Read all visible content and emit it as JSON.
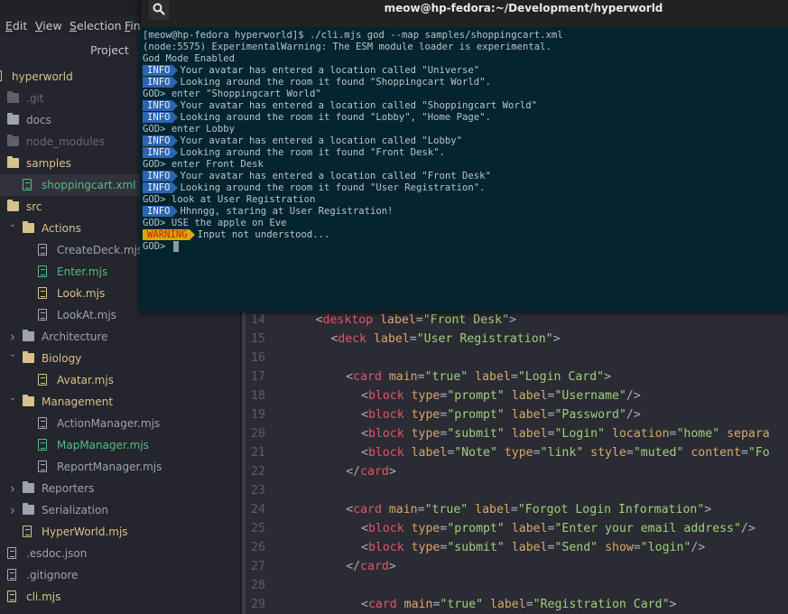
{
  "menubar": {
    "items": [
      {
        "label": "Edit",
        "mnemonic": "E",
        "rest": "dit"
      },
      {
        "label": "View",
        "mnemonic": "V",
        "rest": "iew"
      },
      {
        "label": "Selection",
        "mnemonic": "S",
        "rest": "election"
      },
      {
        "label": "Find",
        "mnemonic": "F",
        "rest": "in"
      }
    ]
  },
  "sidebar": {
    "title": "Project",
    "items": [
      {
        "label": "hyperworld",
        "kind": "root",
        "color": "yellow"
      },
      {
        "label": ".git",
        "kind": "folder",
        "color": "dim"
      },
      {
        "label": "docs",
        "kind": "folder",
        "color": "grey"
      },
      {
        "label": "node_modules",
        "kind": "folder",
        "color": "dim"
      },
      {
        "label": "samples",
        "kind": "folder",
        "color": "yellow"
      },
      {
        "label": "shoppingcart.xml",
        "kind": "file",
        "color": "green",
        "selected": true
      },
      {
        "label": "src",
        "kind": "folder",
        "color": "yellow"
      },
      {
        "label": "Actions",
        "kind": "folder",
        "color": "yellow",
        "expanded": true
      },
      {
        "label": "CreateDeck.mjs",
        "kind": "file",
        "color": "grey"
      },
      {
        "label": "Enter.mjs",
        "kind": "file",
        "color": "green"
      },
      {
        "label": "Look.mjs",
        "kind": "file",
        "color": "yellow"
      },
      {
        "label": "LookAt.mjs",
        "kind": "file",
        "color": "grey"
      },
      {
        "label": "Architecture",
        "kind": "folder",
        "color": "grey",
        "expanded": false
      },
      {
        "label": "Biology",
        "kind": "folder",
        "color": "yellow",
        "expanded": true
      },
      {
        "label": "Avatar.mjs",
        "kind": "file",
        "color": "yellow"
      },
      {
        "label": "Management",
        "kind": "folder",
        "color": "yellow",
        "expanded": true
      },
      {
        "label": "ActionManager.mjs",
        "kind": "file",
        "color": "grey"
      },
      {
        "label": "MapManager.mjs",
        "kind": "file",
        "color": "green"
      },
      {
        "label": "ReportManager.mjs",
        "kind": "file",
        "color": "grey"
      },
      {
        "label": "Reporters",
        "kind": "folder",
        "color": "grey",
        "expanded": false
      },
      {
        "label": "Serialization",
        "kind": "folder",
        "color": "grey",
        "expanded": false
      },
      {
        "label": "HyperWorld.mjs",
        "kind": "file",
        "color": "yellow"
      },
      {
        "label": ".esdoc.json",
        "kind": "file",
        "color": "grey"
      },
      {
        "label": ".gitignore",
        "kind": "file",
        "color": "grey"
      },
      {
        "label": "cli.mjs",
        "kind": "file",
        "color": "yellow"
      }
    ]
  },
  "editor": {
    "lines": [
      {
        "n": "14",
        "indent": 4,
        "tokens": [
          [
            "p",
            "<"
          ],
          [
            "t",
            "desktop"
          ],
          [
            "w",
            " "
          ],
          [
            "a",
            "label"
          ],
          [
            "p",
            "="
          ],
          [
            "s",
            "\"Front Desk\""
          ],
          [
            "p",
            ">"
          ]
        ]
      },
      {
        "n": "15",
        "indent": 6,
        "tokens": [
          [
            "p",
            "<"
          ],
          [
            "t",
            "deck"
          ],
          [
            "w",
            " "
          ],
          [
            "a",
            "label"
          ],
          [
            "p",
            "="
          ],
          [
            "s",
            "\"User Registration\""
          ],
          [
            "p",
            ">"
          ]
        ]
      },
      {
        "n": "16",
        "indent": 0,
        "tokens": []
      },
      {
        "n": "17",
        "indent": 8,
        "tokens": [
          [
            "p",
            "<"
          ],
          [
            "t",
            "card"
          ],
          [
            "w",
            " "
          ],
          [
            "a",
            "main"
          ],
          [
            "p",
            "="
          ],
          [
            "s",
            "\"true\""
          ],
          [
            "w",
            " "
          ],
          [
            "a",
            "label"
          ],
          [
            "p",
            "="
          ],
          [
            "s",
            "\"Login Card\""
          ],
          [
            "p",
            ">"
          ]
        ]
      },
      {
        "n": "18",
        "indent": 10,
        "tokens": [
          [
            "p",
            "<"
          ],
          [
            "t",
            "block"
          ],
          [
            "w",
            " "
          ],
          [
            "a",
            "type"
          ],
          [
            "p",
            "="
          ],
          [
            "s",
            "\"prompt\""
          ],
          [
            "w",
            " "
          ],
          [
            "a",
            "label"
          ],
          [
            "p",
            "="
          ],
          [
            "s",
            "\"Username\""
          ],
          [
            "p",
            "/>"
          ]
        ]
      },
      {
        "n": "19",
        "indent": 10,
        "tokens": [
          [
            "p",
            "<"
          ],
          [
            "t",
            "block"
          ],
          [
            "w",
            " "
          ],
          [
            "a",
            "type"
          ],
          [
            "p",
            "="
          ],
          [
            "s",
            "\"prompt\""
          ],
          [
            "w",
            " "
          ],
          [
            "a",
            "label"
          ],
          [
            "p",
            "="
          ],
          [
            "s",
            "\"Password\""
          ],
          [
            "p",
            "/>"
          ]
        ]
      },
      {
        "n": "20",
        "indent": 10,
        "tokens": [
          [
            "p",
            "<"
          ],
          [
            "t",
            "block"
          ],
          [
            "w",
            " "
          ],
          [
            "a",
            "type"
          ],
          [
            "p",
            "="
          ],
          [
            "s",
            "\"submit\""
          ],
          [
            "w",
            " "
          ],
          [
            "a",
            "label"
          ],
          [
            "p",
            "="
          ],
          [
            "s",
            "\"Login\""
          ],
          [
            "w",
            " "
          ],
          [
            "a",
            "location"
          ],
          [
            "p",
            "="
          ],
          [
            "s",
            "\"home\""
          ],
          [
            "w",
            " "
          ],
          [
            "a",
            "separa"
          ]
        ]
      },
      {
        "n": "21",
        "indent": 10,
        "tokens": [
          [
            "p",
            "<"
          ],
          [
            "t",
            "block"
          ],
          [
            "w",
            " "
          ],
          [
            "a",
            "label"
          ],
          [
            "p",
            "="
          ],
          [
            "s",
            "\"Note\""
          ],
          [
            "w",
            " "
          ],
          [
            "a",
            "type"
          ],
          [
            "p",
            "="
          ],
          [
            "s",
            "\"link\""
          ],
          [
            "w",
            " "
          ],
          [
            "a",
            "style"
          ],
          [
            "p",
            "="
          ],
          [
            "s",
            "\"muted\""
          ],
          [
            "w",
            " "
          ],
          [
            "a",
            "content"
          ],
          [
            "p",
            "="
          ],
          [
            "s",
            "\"Fo"
          ]
        ]
      },
      {
        "n": "22",
        "indent": 8,
        "tokens": [
          [
            "p",
            "</"
          ],
          [
            "t",
            "card"
          ],
          [
            "p",
            ">"
          ]
        ]
      },
      {
        "n": "23",
        "indent": 0,
        "tokens": []
      },
      {
        "n": "24",
        "indent": 8,
        "tokens": [
          [
            "p",
            "<"
          ],
          [
            "t",
            "card"
          ],
          [
            "w",
            " "
          ],
          [
            "a",
            "main"
          ],
          [
            "p",
            "="
          ],
          [
            "s",
            "\"true\""
          ],
          [
            "w",
            " "
          ],
          [
            "a",
            "label"
          ],
          [
            "p",
            "="
          ],
          [
            "s",
            "\"Forgot Login Information\""
          ],
          [
            "p",
            ">"
          ]
        ]
      },
      {
        "n": "25",
        "indent": 10,
        "tokens": [
          [
            "p",
            "<"
          ],
          [
            "t",
            "block"
          ],
          [
            "w",
            " "
          ],
          [
            "a",
            "type"
          ],
          [
            "p",
            "="
          ],
          [
            "s",
            "\"prompt\""
          ],
          [
            "w",
            " "
          ],
          [
            "a",
            "label"
          ],
          [
            "p",
            "="
          ],
          [
            "s",
            "\"Enter your email address\""
          ],
          [
            "p",
            "/>"
          ]
        ]
      },
      {
        "n": "26",
        "indent": 10,
        "tokens": [
          [
            "p",
            "<"
          ],
          [
            "t",
            "block"
          ],
          [
            "w",
            " "
          ],
          [
            "a",
            "type"
          ],
          [
            "p",
            "="
          ],
          [
            "s",
            "\"submit\""
          ],
          [
            "w",
            " "
          ],
          [
            "a",
            "label"
          ],
          [
            "p",
            "="
          ],
          [
            "s",
            "\"Send\""
          ],
          [
            "w",
            " "
          ],
          [
            "a",
            "show"
          ],
          [
            "p",
            "="
          ],
          [
            "s",
            "\"login\""
          ],
          [
            "p",
            "/>"
          ]
        ]
      },
      {
        "n": "27",
        "indent": 8,
        "tokens": [
          [
            "p",
            "</"
          ],
          [
            "t",
            "card"
          ],
          [
            "p",
            ">"
          ]
        ]
      },
      {
        "n": "28",
        "indent": 0,
        "tokens": []
      },
      {
        "n": "29",
        "indent": 10,
        "tokens": [
          [
            "p",
            "<"
          ],
          [
            "t",
            "card"
          ],
          [
            "w",
            " "
          ],
          [
            "a",
            "main"
          ],
          [
            "p",
            "="
          ],
          [
            "s",
            "\"true\""
          ],
          [
            "w",
            " "
          ],
          [
            "a",
            "label"
          ],
          [
            "p",
            "="
          ],
          [
            "s",
            "\"Registration Card\""
          ],
          [
            "p",
            ">"
          ]
        ]
      }
    ]
  },
  "terminal": {
    "title": "meow@hp-fedora:~/Development/hyperworld",
    "search_icon": "search-icon",
    "lines": [
      {
        "type": "plain",
        "text": "[meow@hp-fedora hyperworld]$ ./cli.mjs god --map samples/shoppingcart.xml"
      },
      {
        "type": "plain",
        "text": "(node:5575) ExperimentalWarning: The ESM module loader is experimental."
      },
      {
        "type": "plain",
        "text": "God Mode Enabled"
      },
      {
        "type": "info",
        "badge": "INFO",
        "text": "Your avatar has entered a location called \"Universe\""
      },
      {
        "type": "info",
        "badge": "INFO",
        "text": "Looking around the room it found \"Shoppingcart World\"."
      },
      {
        "type": "plain",
        "text": "GOD> enter \"Shoppingcart World\""
      },
      {
        "type": "info",
        "badge": "INFO",
        "text": "Your avatar has entered a location called \"Shoppingcart World\""
      },
      {
        "type": "info",
        "badge": "INFO",
        "text": "Looking around the room it found \"Lobby\", \"Home Page\"."
      },
      {
        "type": "plain",
        "text": "GOD> enter Lobby"
      },
      {
        "type": "info",
        "badge": "INFO",
        "text": "Your avatar has entered a location called \"Lobby\""
      },
      {
        "type": "info",
        "badge": "INFO",
        "text": "Looking around the room it found \"Front Desk\"."
      },
      {
        "type": "plain",
        "text": "GOD> enter Front Desk"
      },
      {
        "type": "info",
        "badge": "INFO",
        "text": "Your avatar has entered a location called \"Front Desk\""
      },
      {
        "type": "info",
        "badge": "INFO",
        "text": "Looking around the room it found \"User Registration\"."
      },
      {
        "type": "plain",
        "text": "GOD> look at User Registration"
      },
      {
        "type": "info",
        "badge": "INFO",
        "text": "Hhnngg, staring at User Registration!"
      },
      {
        "type": "plain",
        "text": "GOD> USE the apple on Eve"
      },
      {
        "type": "warn",
        "badge": "WARNING",
        "text": "Input not understood..."
      },
      {
        "type": "prompt",
        "text": "GOD> "
      }
    ]
  }
}
